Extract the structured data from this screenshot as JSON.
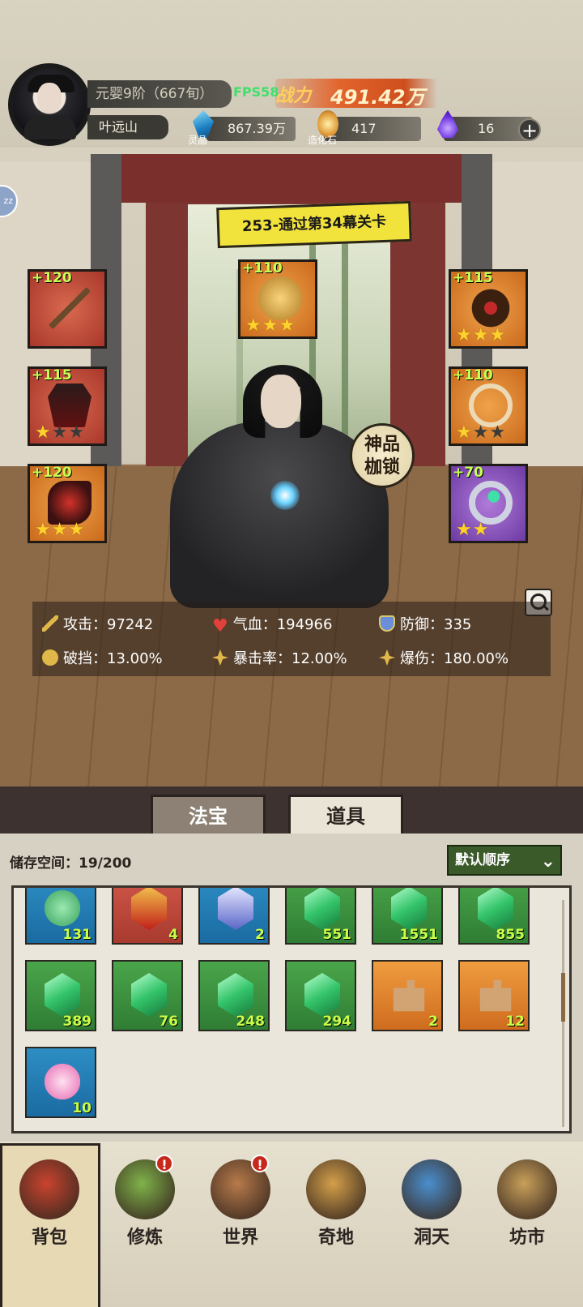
{
  "player": {
    "realm": "元婴9阶（667旬）",
    "name": "叶远山",
    "fps": "FPS58",
    "power_label": "战力",
    "power_value": "491.42万"
  },
  "resources": {
    "crystal": {
      "value": "867.39万",
      "label": "灵晶",
      "icon": "crystal-icon"
    },
    "stone": {
      "value": "417",
      "label": "造化石",
      "icon": "stone-icon"
    },
    "flame": {
      "value": "16",
      "icon": "flame-icon"
    },
    "add_label": "+"
  },
  "quest": "253-通过第34幕关卡",
  "badge": "神品\n枷锁",
  "sleep_button": "zz",
  "equipment": [
    {
      "slot": "weapon",
      "level": "+120",
      "rarity": "red",
      "stars": 0,
      "max_stars": 0
    },
    {
      "slot": "top-center",
      "level": "+110",
      "rarity": "orange",
      "stars": 3,
      "max_stars": 3
    },
    {
      "slot": "crown",
      "level": "+115",
      "rarity": "orange",
      "stars": 3,
      "max_stars": 3
    },
    {
      "slot": "armor",
      "level": "+115",
      "rarity": "red",
      "stars": 1,
      "max_stars": 3
    },
    {
      "slot": "amulet",
      "level": "+110",
      "rarity": "orange",
      "stars": 1,
      "max_stars": 3
    },
    {
      "slot": "boots",
      "level": "+120",
      "rarity": "orange",
      "stars": 3,
      "max_stars": 3
    },
    {
      "slot": "ring",
      "level": "+70",
      "rarity": "purple",
      "stars": 2,
      "max_stars": 2
    }
  ],
  "stats": {
    "attack": "攻击：97242",
    "hp": "气血：194966",
    "defense": "防御：335",
    "block_break": "破挡：13.00%",
    "crit_rate": "暴击率：12.00%",
    "crit_damage": "爆伤：180.00%"
  },
  "tabs": {
    "fabao": "法宝",
    "daoju": "道具"
  },
  "inventory": {
    "storage": "储存空间：19/200",
    "sort": "默认顺序",
    "sort_icon": "chevron-down-icon",
    "items": [
      {
        "color": "blue",
        "kind": "jade",
        "count": "131"
      },
      {
        "color": "red",
        "kind": "ornament",
        "count": "4"
      },
      {
        "color": "blue",
        "kind": "boot",
        "count": "2"
      },
      {
        "color": "green",
        "kind": "gem",
        "count": "551"
      },
      {
        "color": "green",
        "kind": "gem",
        "count": "1551"
      },
      {
        "color": "green",
        "kind": "gem",
        "count": "855"
      },
      {
        "color": "green",
        "kind": "gem",
        "count": "389"
      },
      {
        "color": "green",
        "kind": "gem",
        "count": "76"
      },
      {
        "color": "green",
        "kind": "gem",
        "count": "248"
      },
      {
        "color": "green",
        "kind": "gem",
        "count": "294"
      },
      {
        "color": "orange",
        "kind": "piece",
        "count": "2"
      },
      {
        "color": "orange",
        "kind": "piece",
        "count": "12"
      },
      {
        "color": "blue",
        "kind": "flower",
        "count": "10"
      }
    ]
  },
  "nav": [
    {
      "label": "背包",
      "icon": "bag-icon",
      "alert": ""
    },
    {
      "label": "修炼",
      "icon": "lotus-icon",
      "alert": "!"
    },
    {
      "label": "世界",
      "icon": "scroll-map-icon",
      "alert": "!"
    },
    {
      "label": "奇地",
      "icon": "mountain-icon",
      "alert": ""
    },
    {
      "label": "洞天",
      "icon": "portal-icon",
      "alert": ""
    },
    {
      "label": "坊市",
      "icon": "market-icon",
      "alert": ""
    }
  ]
}
